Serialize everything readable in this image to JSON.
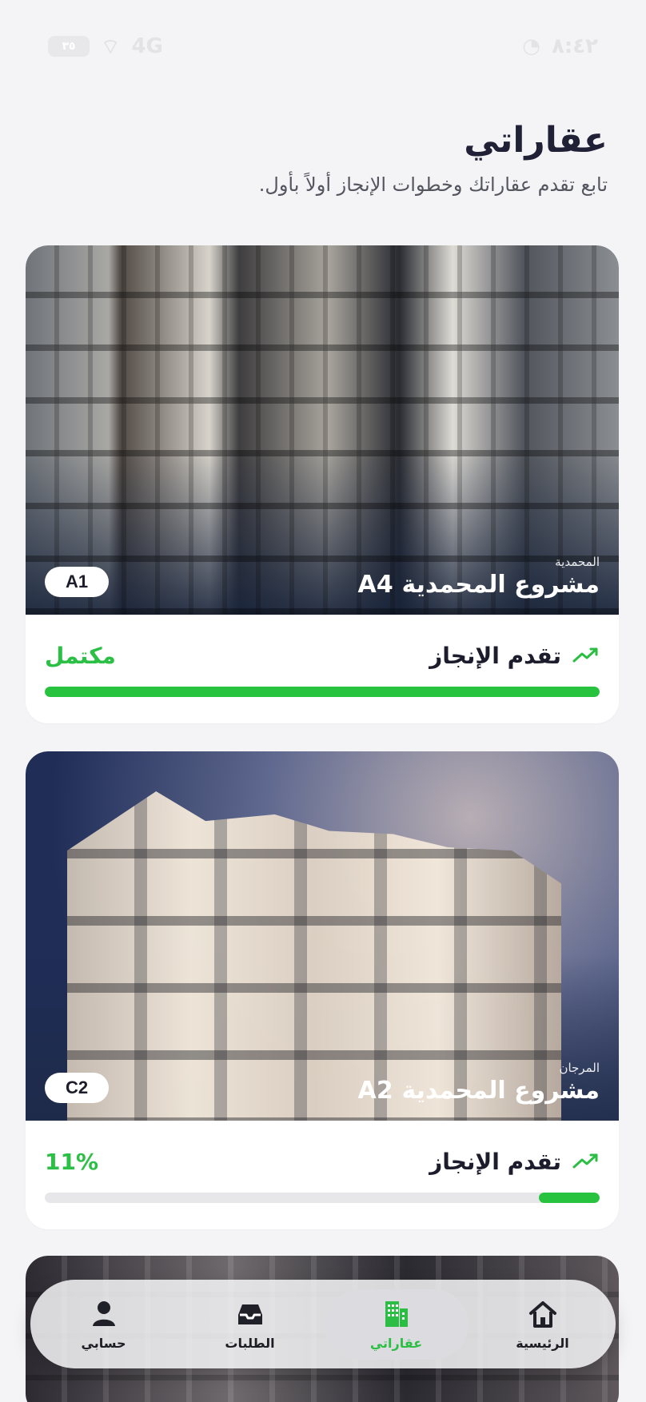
{
  "status_bar": {
    "time": "٨:٤٢",
    "battery": "٣٥",
    "network": "4G"
  },
  "header": {
    "title": "عقاراتي",
    "subtitle": "تابع تقدم عقاراتك وخطوات الإنجاز أولاً بأول."
  },
  "properties": [
    {
      "district": "المحمدية",
      "title": "مشروع المحمدية A4",
      "unit": "A1",
      "progress_label": "تقدم الإنجاز",
      "progress_value_text": "مكتمل",
      "progress_fraction": 1.0
    },
    {
      "district": "المرجان",
      "title": "مشروع المحمدية A2",
      "unit": "C2",
      "progress_label": "تقدم الإنجاز",
      "progress_value_text": "11%",
      "progress_fraction": 0.11
    }
  ],
  "bottom_nav": {
    "items": [
      {
        "label": "الرئيسية",
        "icon": "home-icon"
      },
      {
        "label": "عقاراتي",
        "icon": "building-icon"
      },
      {
        "label": "الطلبات",
        "icon": "inbox-icon"
      },
      {
        "label": "حسابي",
        "icon": "user-icon"
      }
    ],
    "active_index": 1
  },
  "colors": {
    "accent": "#2cbe44",
    "text": "#1c1c2c",
    "background": "#f4f4f7"
  }
}
